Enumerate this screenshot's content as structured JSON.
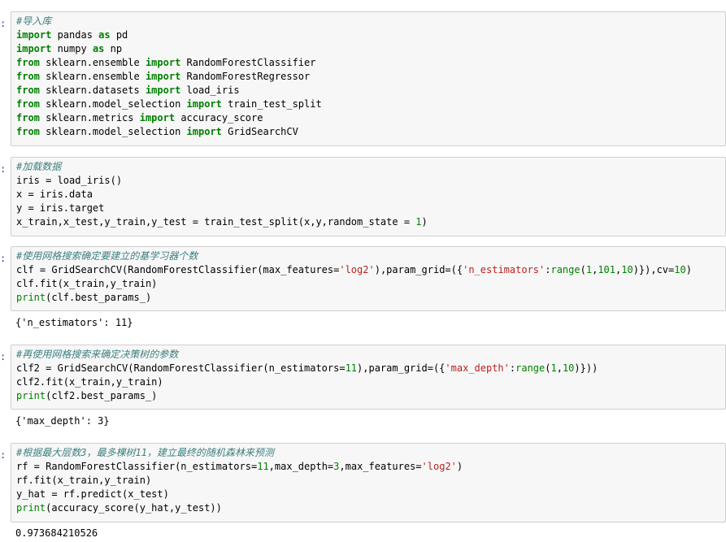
{
  "cells": [
    {
      "prompt": ":",
      "lines": [
        [
          {
            "t": "cm",
            "v": "#导入库"
          }
        ],
        [
          {
            "t": "kw",
            "v": "import"
          },
          {
            "t": "",
            "v": " pandas "
          },
          {
            "t": "kw",
            "v": "as"
          },
          {
            "t": "",
            "v": " pd"
          }
        ],
        [
          {
            "t": "kw",
            "v": "import"
          },
          {
            "t": "",
            "v": " numpy "
          },
          {
            "t": "kw",
            "v": "as"
          },
          {
            "t": "",
            "v": " np"
          }
        ],
        [
          {
            "t": "kw",
            "v": "from"
          },
          {
            "t": "",
            "v": " sklearn.ensemble "
          },
          {
            "t": "kw",
            "v": "import"
          },
          {
            "t": "",
            "v": " RandomForestClassifier"
          }
        ],
        [
          {
            "t": "kw",
            "v": "from"
          },
          {
            "t": "",
            "v": " sklearn.ensemble "
          },
          {
            "t": "kw",
            "v": "import"
          },
          {
            "t": "",
            "v": " RandomForestRegressor"
          }
        ],
        [
          {
            "t": "kw",
            "v": "from"
          },
          {
            "t": "",
            "v": " sklearn.datasets "
          },
          {
            "t": "kw",
            "v": "import"
          },
          {
            "t": "",
            "v": " load_iris"
          }
        ],
        [
          {
            "t": "kw",
            "v": "from"
          },
          {
            "t": "",
            "v": " sklearn.model_selection "
          },
          {
            "t": "kw",
            "v": "import"
          },
          {
            "t": "",
            "v": " train_test_split"
          }
        ],
        [
          {
            "t": "kw",
            "v": "from"
          },
          {
            "t": "",
            "v": " sklearn.metrics "
          },
          {
            "t": "kw",
            "v": "import"
          },
          {
            "t": "",
            "v": " accuracy_score"
          }
        ],
        [
          {
            "t": "kw",
            "v": "from"
          },
          {
            "t": "",
            "v": " sklearn.model_selection "
          },
          {
            "t": "kw",
            "v": "import"
          },
          {
            "t": "",
            "v": " GridSearchCV"
          }
        ]
      ],
      "output": ""
    },
    {
      "prompt": ":",
      "lines": [
        [
          {
            "t": "cm",
            "v": "#加载数据"
          }
        ],
        [
          {
            "t": "",
            "v": "iris = load_iris()"
          }
        ],
        [
          {
            "t": "",
            "v": "x = iris.data"
          }
        ],
        [
          {
            "t": "",
            "v": "y = iris.target"
          }
        ],
        [
          {
            "t": "",
            "v": "x_train,x_test,y_train,y_test = train_test_split(x,y,random_state = "
          },
          {
            "t": "nu",
            "v": "1"
          },
          {
            "t": "",
            "v": ")"
          }
        ]
      ],
      "output": ""
    },
    {
      "prompt": ":",
      "lines": [
        [
          {
            "t": "cm",
            "v": "#使用网格搜索确定要建立的基学习器个数"
          }
        ],
        [
          {
            "t": "",
            "v": "clf = GridSearchCV(RandomForestClassifier(max_features="
          },
          {
            "t": "st",
            "v": "'log2'"
          },
          {
            "t": "",
            "v": "),param_grid=({"
          },
          {
            "t": "st",
            "v": "'n_estimators'"
          },
          {
            "t": "",
            "v": ":"
          },
          {
            "t": "bi",
            "v": "range"
          },
          {
            "t": "",
            "v": "("
          },
          {
            "t": "nu",
            "v": "1"
          },
          {
            "t": "",
            "v": ","
          },
          {
            "t": "nu",
            "v": "101"
          },
          {
            "t": "",
            "v": ","
          },
          {
            "t": "nu",
            "v": "10"
          },
          {
            "t": "",
            "v": ")}),cv="
          },
          {
            "t": "nu",
            "v": "10"
          },
          {
            "t": "",
            "v": ")"
          }
        ],
        [
          {
            "t": "",
            "v": "clf.fit(x_train,y_train)"
          }
        ],
        [
          {
            "t": "bi",
            "v": "print"
          },
          {
            "t": "",
            "v": "(clf.best_params_)"
          }
        ]
      ],
      "output": "{'n_estimators': 11}"
    },
    {
      "prompt": ":",
      "lines": [
        [
          {
            "t": "cm",
            "v": "#再使用网格搜索来确定决策树的参数"
          }
        ],
        [
          {
            "t": "",
            "v": "clf2 = GridSearchCV(RandomForestClassifier(n_estimators="
          },
          {
            "t": "nu",
            "v": "11"
          },
          {
            "t": "",
            "v": "),param_grid=({"
          },
          {
            "t": "st",
            "v": "'max_depth'"
          },
          {
            "t": "",
            "v": ":"
          },
          {
            "t": "bi",
            "v": "range"
          },
          {
            "t": "",
            "v": "("
          },
          {
            "t": "nu",
            "v": "1"
          },
          {
            "t": "",
            "v": ","
          },
          {
            "t": "nu",
            "v": "10"
          },
          {
            "t": "",
            "v": ")}))"
          }
        ],
        [
          {
            "t": "",
            "v": "clf2.fit(x_train,y_train)"
          }
        ],
        [
          {
            "t": "bi",
            "v": "print"
          },
          {
            "t": "",
            "v": "(clf2.best_params_)"
          }
        ]
      ],
      "output": "{'max_depth': 3}"
    },
    {
      "prompt": ":",
      "lines": [
        [
          {
            "t": "cm",
            "v": "#根据最大层数3，最多棵树11，建立最终的随机森林来预测"
          }
        ],
        [
          {
            "t": "",
            "v": "rf = RandomForestClassifier(n_estimators="
          },
          {
            "t": "nu",
            "v": "11"
          },
          {
            "t": "",
            "v": ",max_depth="
          },
          {
            "t": "nu",
            "v": "3"
          },
          {
            "t": "",
            "v": ",max_features="
          },
          {
            "t": "st",
            "v": "'log2'"
          },
          {
            "t": "",
            "v": ")"
          }
        ],
        [
          {
            "t": "",
            "v": "rf.fit(x_train,y_train)"
          }
        ],
        [
          {
            "t": "",
            "v": "y_hat = rf.predict(x_test)"
          }
        ],
        [
          {
            "t": "bi",
            "v": "print"
          },
          {
            "t": "",
            "v": "(accuracy_score(y_hat,y_test))"
          }
        ]
      ],
      "output": "0.973684210526"
    }
  ]
}
